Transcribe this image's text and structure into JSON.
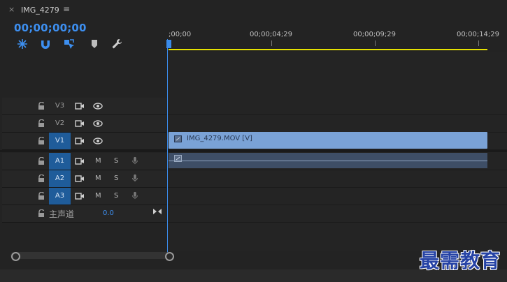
{
  "tab": {
    "title": "IMG_4279",
    "close": "×",
    "menu": "≡"
  },
  "timecode": "00;00;00;00",
  "ruler": {
    "labels": [
      ";00;00",
      "00;00;04;29",
      "00;00;09;29",
      "00;00;14;29"
    ]
  },
  "tracks": {
    "video": [
      {
        "name": "V3",
        "active": false
      },
      {
        "name": "V2",
        "active": false
      },
      {
        "name": "V1",
        "active": true
      }
    ],
    "audio": [
      {
        "name": "A1",
        "active": true,
        "mute": "M",
        "solo": "S"
      },
      {
        "name": "A2",
        "active": true,
        "mute": "M",
        "solo": "S"
      },
      {
        "name": "A3",
        "active": true,
        "mute": "M",
        "solo": "S"
      }
    ],
    "master": {
      "name": "主声道",
      "value": "0.0"
    }
  },
  "clips": {
    "video_clip_name": "IMG_4279.MOV [V]"
  },
  "watermark": "最需教育",
  "colors": {
    "accent": "#3d8ff0",
    "video_clip": "#7aa2d6",
    "audio_clip": "#3e4e66",
    "workbar": "#e6e200"
  }
}
